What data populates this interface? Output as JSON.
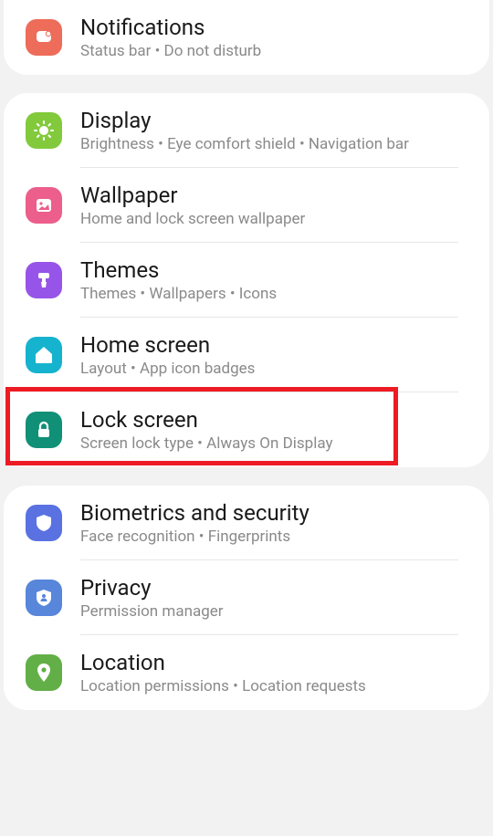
{
  "groups": [
    {
      "items": [
        {
          "id": "notifications",
          "title": "Notifications",
          "subtitle": "Status bar  •  Do not disturb",
          "iconColor": "#ed6c5a",
          "iconName": "bell-icon"
        }
      ]
    },
    {
      "items": [
        {
          "id": "display",
          "title": "Display",
          "subtitle": "Brightness  •  Eye comfort shield  •  Navigation bar",
          "iconColor": "#82ca3c",
          "iconName": "sun-icon"
        },
        {
          "id": "wallpaper",
          "title": "Wallpaper",
          "subtitle": "Home and lock screen wallpaper",
          "iconColor": "#ec5e8b",
          "iconName": "picture-icon"
        },
        {
          "id": "themes",
          "title": "Themes",
          "subtitle": "Themes  •  Wallpapers  •  Icons",
          "iconColor": "#9754e8",
          "iconName": "brush-icon"
        },
        {
          "id": "home-screen",
          "title": "Home screen",
          "subtitle": "Layout  •  App icon badges",
          "iconColor": "#16b3cf",
          "iconName": "home-icon"
        },
        {
          "id": "lock-screen",
          "title": "Lock screen",
          "subtitle": "Screen lock type  •  Always On Display",
          "iconColor": "#109077",
          "iconName": "lock-icon",
          "highlighted": true
        }
      ]
    },
    {
      "items": [
        {
          "id": "biometrics",
          "title": "Biometrics and security",
          "subtitle": "Face recognition  •  Fingerprints",
          "iconColor": "#5a71e2",
          "iconName": "shield-icon"
        },
        {
          "id": "privacy",
          "title": "Privacy",
          "subtitle": "Permission manager",
          "iconColor": "#5786db",
          "iconName": "privacy-shield-icon"
        },
        {
          "id": "location",
          "title": "Location",
          "subtitle": "Location permissions  •  Location requests",
          "iconColor": "#62af47",
          "iconName": "pin-icon"
        }
      ]
    }
  ]
}
